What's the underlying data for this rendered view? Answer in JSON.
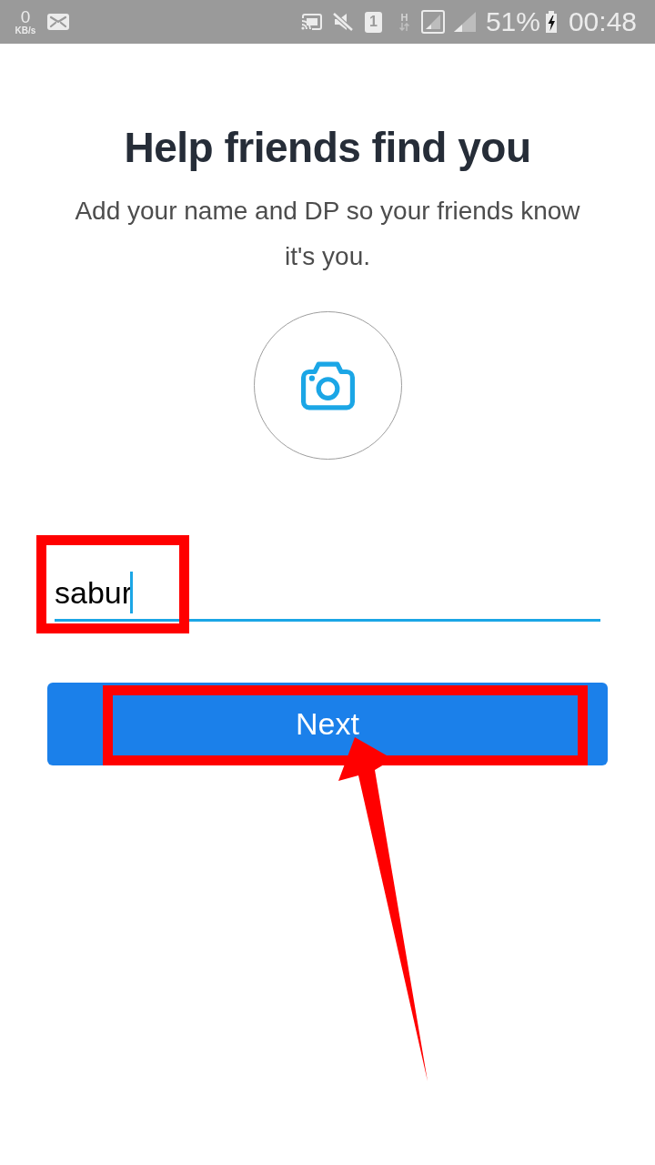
{
  "status_bar": {
    "speed": "0",
    "speed_unit": "KB/s",
    "sim_label": "1",
    "network_type": "H",
    "battery": "51%",
    "charging": true,
    "time": "00:48"
  },
  "heading": "Help friends find you",
  "subtitle": "Add your name and DP so your friends know it's you.",
  "name_field": {
    "value": "sabur",
    "focused": true
  },
  "next_button": {
    "label": "Next"
  },
  "annotations": [
    {
      "kind": "frame"
    },
    {
      "kind": "frame"
    },
    {
      "kind": "arrow"
    }
  ]
}
